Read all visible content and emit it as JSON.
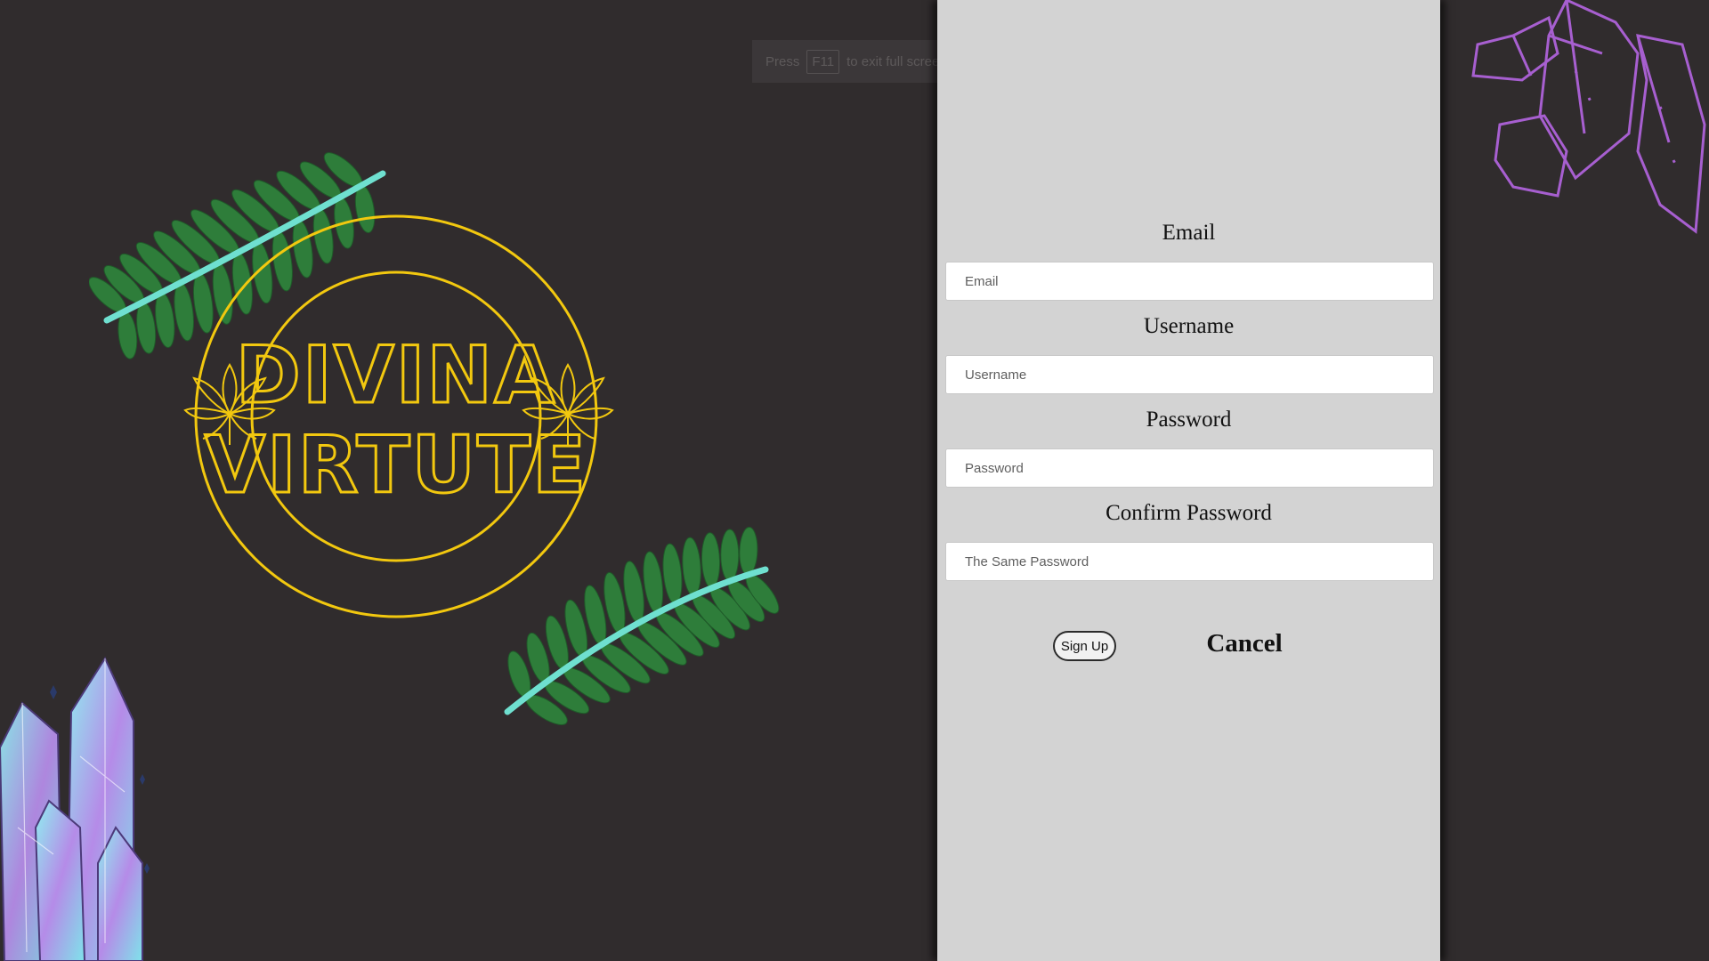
{
  "fullscreen_notice": {
    "press": "Press",
    "key": "F11",
    "rest": "to exit full screen"
  },
  "logo": {
    "line1": "DIVINA",
    "line2": "VIRTUTE"
  },
  "form": {
    "email_label": "Email",
    "email_placeholder": "Email",
    "username_label": "Username",
    "username_placeholder": "Username",
    "password_label": "Password",
    "password_placeholder": "Password",
    "confirm_label": "Confirm Password",
    "confirm_placeholder": "The Same Password",
    "signup_label": "Sign Up",
    "cancel_label": "Cancel"
  },
  "colors": {
    "background": "#302c2d",
    "panel": "#d3d3d3",
    "logo_gold": "#f2c80f",
    "fern_green": "#2e7d3a",
    "fern_stem": "#6fe0d0",
    "crystal_purple": "#9b59c9"
  }
}
